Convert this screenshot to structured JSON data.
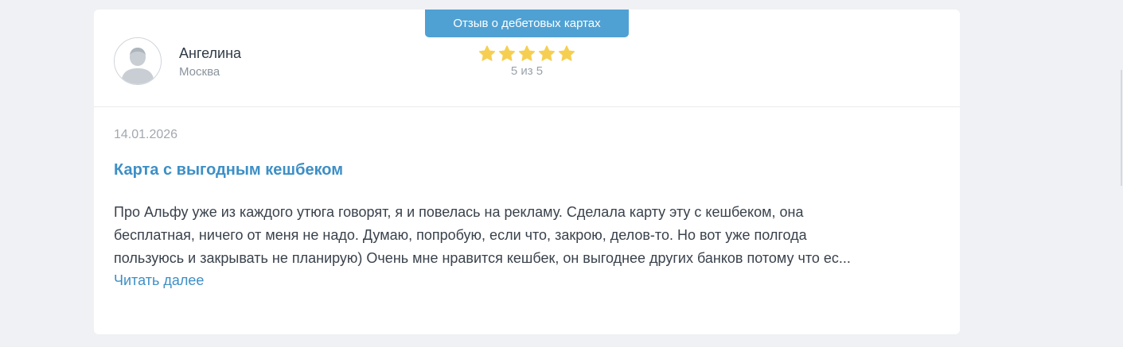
{
  "review": {
    "category": "Отзыв о дебетовых картах",
    "author": {
      "name": "Ангелина",
      "city": "Москва",
      "avatar_icon": "user-silhouette-icon"
    },
    "rating": {
      "value": 5,
      "max": 5,
      "text": "5 из 5",
      "star_icon": "star-icon",
      "star_color": "#f6cf52"
    },
    "date": "14.01.2026",
    "title": "Карта с выгодным кешбеком",
    "text": "Про Альфу уже из каждого утюга говорят, я и повелась на рекламу. Сделала карту эту с кешбеком, она\nбесплатная, ничего от меня не надо. Думаю, попробую, если что, закрою, делов-то. Но вот уже полгода\nпользуюсь и закрывать не планирую) Очень мне нравится кешбек, он выгоднее других банков потому что ес...",
    "read_more": "Читать далее"
  },
  "colors": {
    "accent": "#4fa1d3",
    "link": "#3d8fc6",
    "background": "#eff1f4"
  }
}
